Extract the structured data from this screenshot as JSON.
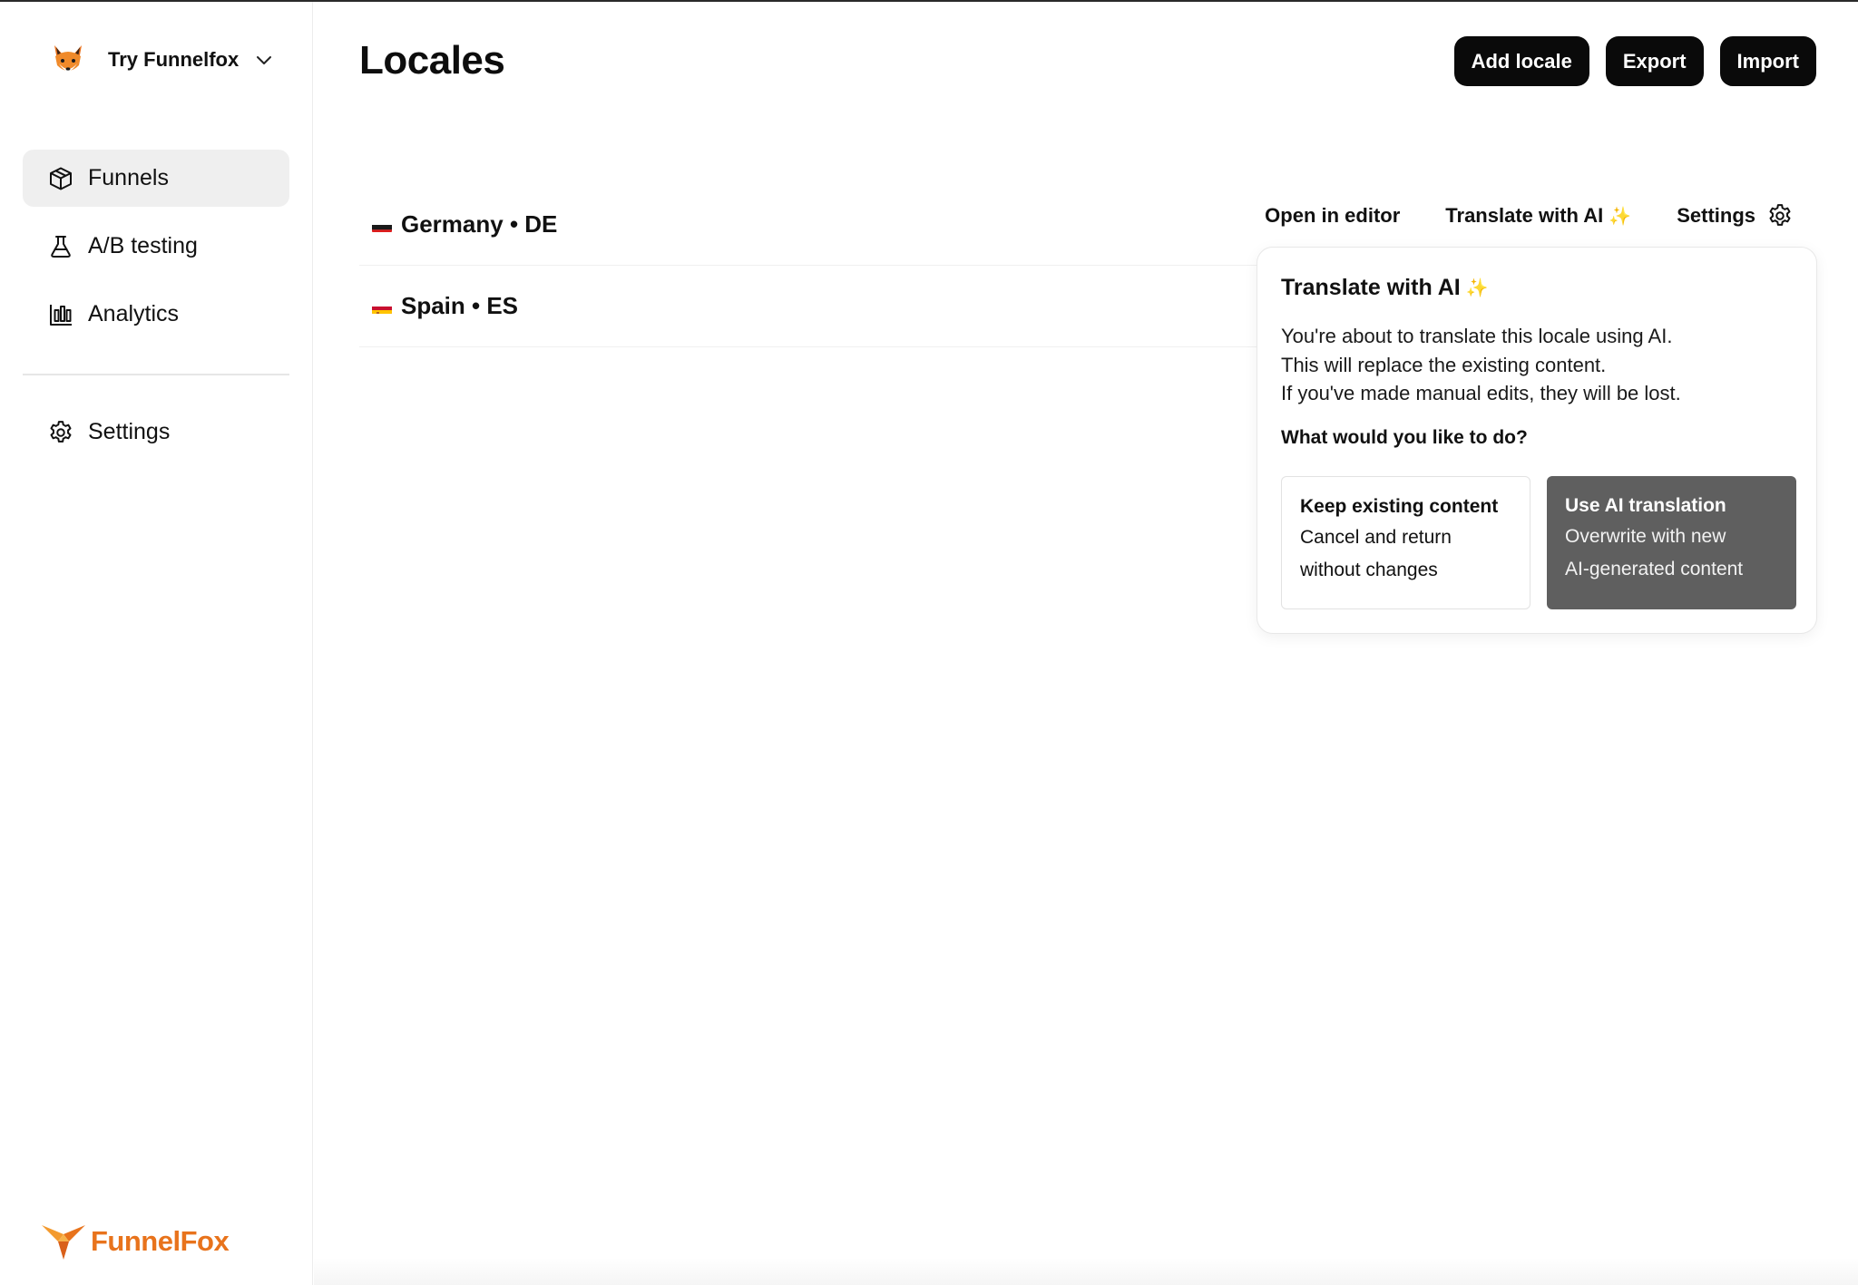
{
  "workspace": {
    "name": "Try Funnelfox"
  },
  "sidebar": {
    "items": [
      {
        "label": "Funnels",
        "icon": "box-icon",
        "active": true
      },
      {
        "label": "A/B testing",
        "icon": "flask-icon",
        "active": false
      },
      {
        "label": "Analytics",
        "icon": "bar-chart-icon",
        "active": false
      }
    ],
    "settings": {
      "label": "Settings",
      "icon": "gear-icon"
    }
  },
  "brand": {
    "name": "FunnelFox",
    "color": "#e8731c"
  },
  "page": {
    "title": "Locales"
  },
  "toolbar": {
    "add_label": "Add locale",
    "export_label": "Export",
    "import_label": "Import"
  },
  "locales": [
    {
      "name": "Germany • DE",
      "flag": "germany-flag-icon"
    },
    {
      "name": "Spain • ES",
      "flag": "spain-flag-icon"
    }
  ],
  "row_actions": {
    "open_label": "Open in editor",
    "translate_label": "Translate with AI",
    "settings_label": "Settings"
  },
  "popover": {
    "title": "Translate with AI",
    "lines": [
      "You're about to translate this locale using AI.",
      "This will replace the existing content.",
      "If you've made manual edits, they will be lost."
    ],
    "question": "What would you like to do?",
    "keep": {
      "title": "Keep existing content",
      "desc_1": "Cancel and return",
      "desc_2": "without changes"
    },
    "use": {
      "title": "Use AI translation",
      "desc_1": "Overwrite with new",
      "desc_2": "AI-generated content"
    }
  }
}
